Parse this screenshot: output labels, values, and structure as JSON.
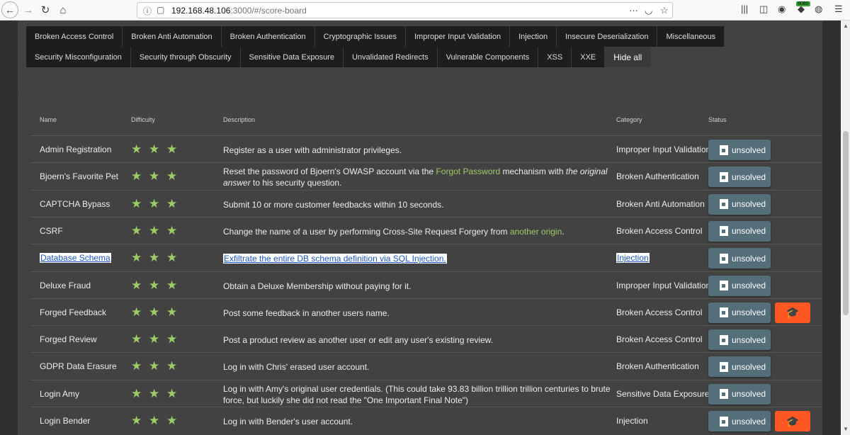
{
  "browser": {
    "url_host": "192.168.48.106",
    "url_path": ":3000/#/score-board",
    "proxy_badge": "8080"
  },
  "filters": {
    "categories": [
      "Broken Access Control",
      "Broken Anti Automation",
      "Broken Authentication",
      "Cryptographic Issues",
      "Improper Input Validation",
      "Injection",
      "Insecure Deserialization",
      "Miscellaneous",
      "Security Misconfiguration",
      "Security through Obscurity",
      "Sensitive Data Exposure",
      "Unvalidated Redirects",
      "Vulnerable Components",
      "XSS",
      "XXE"
    ],
    "toggle_label": "Hide all"
  },
  "table": {
    "headers": {
      "name": "Name",
      "difficulty": "Difficulty",
      "description": "Description",
      "category": "Category",
      "status": "Status"
    },
    "rows": [
      {
        "name": "Admin Registration",
        "difficulty": 3,
        "desc_parts": [
          {
            "t": "Register as a user with administrator privileges."
          }
        ],
        "category": "Improper Input Validation",
        "status": "unsolved",
        "has_tutorial": false
      },
      {
        "name": "Bjoern's Favorite Pet",
        "difficulty": 3,
        "desc_parts": [
          {
            "t": "Reset the password of Bjoern's OWASP account via the "
          },
          {
            "t": "Forgot Password",
            "k": "link"
          },
          {
            "t": " mechanism with "
          },
          {
            "t": "the original answer",
            "k": "em"
          },
          {
            "t": " to his security question."
          }
        ],
        "category": "Broken Authentication",
        "status": "unsolved",
        "has_tutorial": false
      },
      {
        "name": "CAPTCHA Bypass",
        "difficulty": 3,
        "desc_parts": [
          {
            "t": "Submit 10 or more customer feedbacks within 10 seconds."
          }
        ],
        "category": "Broken Anti Automation",
        "status": "unsolved",
        "has_tutorial": false
      },
      {
        "name": "CSRF",
        "difficulty": 3,
        "desc_parts": [
          {
            "t": "Change the name of a user by performing Cross-Site Request Forgery from "
          },
          {
            "t": "another origin",
            "k": "link"
          },
          {
            "t": "."
          }
        ],
        "category": "Broken Access Control",
        "status": "unsolved",
        "has_tutorial": false
      },
      {
        "name": "Database Schema",
        "difficulty": 3,
        "desc_parts": [
          {
            "t": "Exfiltrate the entire DB schema definition via SQL Injection."
          }
        ],
        "category": "Injection",
        "status": "unsolved",
        "has_tutorial": false,
        "selected": true
      },
      {
        "name": "Deluxe Fraud",
        "difficulty": 3,
        "desc_parts": [
          {
            "t": "Obtain a Deluxe Membership without paying for it."
          }
        ],
        "category": "Improper Input Validation",
        "status": "unsolved",
        "has_tutorial": false
      },
      {
        "name": "Forged Feedback",
        "difficulty": 3,
        "desc_parts": [
          {
            "t": "Post some feedback in another users name."
          }
        ],
        "category": "Broken Access Control",
        "status": "unsolved",
        "has_tutorial": true
      },
      {
        "name": "Forged Review",
        "difficulty": 3,
        "desc_parts": [
          {
            "t": "Post a product review as another user or edit any user's existing review."
          }
        ],
        "category": "Broken Access Control",
        "status": "unsolved",
        "has_tutorial": false
      },
      {
        "name": "GDPR Data Erasure",
        "difficulty": 3,
        "desc_parts": [
          {
            "t": "Log in with Chris' erased user account."
          }
        ],
        "category": "Broken Authentication",
        "status": "unsolved",
        "has_tutorial": false
      },
      {
        "name": "Login Amy",
        "difficulty": 3,
        "desc_parts": [
          {
            "t": "Log in with Amy's original user credentials. (This could take 93.83 billion trillion trillion centuries to brute force, but luckily she did not read the \"One Important Final Note\")"
          }
        ],
        "category": "Sensitive Data Exposure",
        "status": "unsolved",
        "has_tutorial": false
      },
      {
        "name": "Login Bender",
        "difficulty": 3,
        "desc_parts": [
          {
            "t": "Log in with Bender's user account."
          }
        ],
        "category": "Injection",
        "status": "unsolved",
        "has_tutorial": true
      }
    ]
  },
  "colors": {
    "star": "#9ccc65",
    "status_button": "#546e7a",
    "tutorial_button": "#ff5722",
    "link": "#9ccc65"
  },
  "icons": {
    "status": "flag-icon",
    "tutorial": "graduation-cap-icon"
  }
}
